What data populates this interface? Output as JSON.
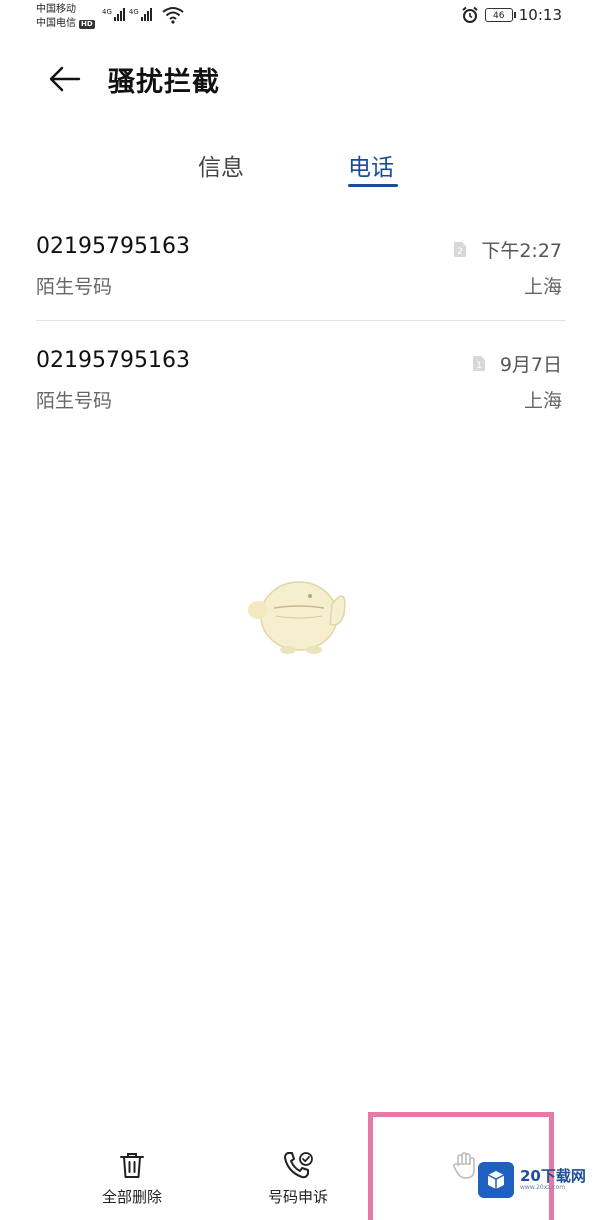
{
  "status_bar": {
    "carrier_1": "中国移动",
    "carrier_2": "中国电信",
    "hd_badge": "HD",
    "signal_1_label": "4G",
    "signal_2_label": "4G",
    "battery_level": "46",
    "time": "10:13",
    "icons": [
      "signal-icon",
      "wifi-icon",
      "alarm-icon",
      "battery-icon"
    ]
  },
  "header": {
    "title": "骚扰拦截",
    "back_icon": "arrow-left-icon"
  },
  "tabs": [
    {
      "label": "信息",
      "active": false
    },
    {
      "label": "电话",
      "active": true
    }
  ],
  "accent_color": "#1a4c9c",
  "calls": [
    {
      "number": "02195795163",
      "type": "陌生号码",
      "time": "下午2:27",
      "location": "上海",
      "sim": "2"
    },
    {
      "number": "02195795163",
      "type": "陌生号码",
      "time": "9月7日",
      "location": "上海",
      "sim": "1"
    }
  ],
  "bottom_bar": {
    "delete_all": "全部删除",
    "appeal_number": "号码申诉"
  },
  "watermark": {
    "brand": "20下载网",
    "domain": "www.20xz.com"
  }
}
